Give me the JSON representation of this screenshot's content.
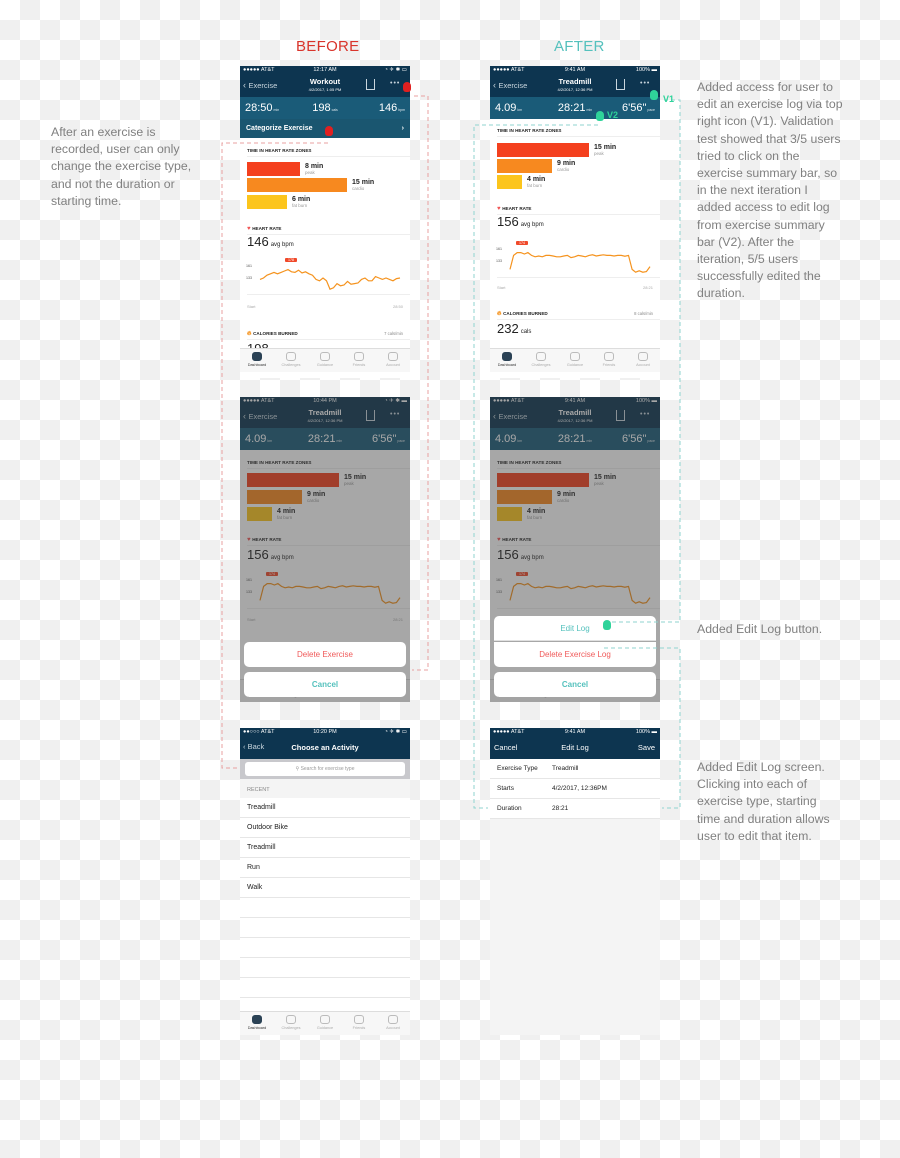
{
  "labels": {
    "before": "BEFORE",
    "after": "AFTER",
    "before_color": "#d9342b",
    "after_color": "#55c1bd"
  },
  "notes": {
    "left": "After an exercise is\nrecorded, user can only\nchange the exercise type,\nand not the duration or\nstarting time.",
    "v1v2": "Added access for user to\nedit an exercise log via top\nright icon (V1). Validation\ntest showed that 3/5 users\ntried to click on the\nexercise summary bar, so\nin the next iteration I\nadded access to edit log\nfrom exercise summary\nbar (V2). After the\niteration, 5/5 users\nsuccessfully edited the\nduration.",
    "edit_button": "Added Edit Log button.",
    "edit_screen": "Added Edit Log screen.\nClicking into each of\nexercise type, starting\ntime and duration allows\nuser to edit that item."
  },
  "markers": {
    "v1": "V1",
    "v2": "V2"
  },
  "tabs": [
    "Dashboard",
    "Challenges",
    "Guidance",
    "Friends",
    "Account"
  ],
  "before_summary": {
    "status": {
      "carrier": "●●●●● AT&T",
      "time": "12:17 AM",
      "right": "◔ ✈ ✱ ▭"
    },
    "nav": {
      "back": "Exercise",
      "title": "Workout",
      "subtitle": "4/2/2017, 1:05 PM"
    },
    "stats": [
      {
        "value": "28:50",
        "unit": "min"
      },
      {
        "value": "198",
        "unit": "cals"
      },
      {
        "value": "146",
        "unit": "bpm"
      }
    ],
    "categorize": "Categorize Exercise",
    "zones_title": "TIME IN HEART RATE ZONES",
    "zones": [
      {
        "value": "8 min",
        "label": "peak"
      },
      {
        "value": "15 min",
        "label": "cardio"
      },
      {
        "value": "6 min",
        "label": "fat burn"
      }
    ],
    "heart_title": "HEART RATE",
    "avg": "146",
    "avg_unit": "avg bpm",
    "ticks": [
      "161",
      "133"
    ],
    "peak_badge": "178",
    "x_start": "Start",
    "x_end": "28:50",
    "cal_title": "CALORIES BURNED",
    "cal_rate": "7 cals/min",
    "cal_value": "198"
  },
  "after_summary": {
    "status": {
      "carrier": "●●●●● AT&T",
      "time": "9:41 AM",
      "right": "100% ▬"
    },
    "nav": {
      "back": "Exercise",
      "title": "Treadmill",
      "subtitle": "4/2/2017, 12:36 PM"
    },
    "stats": [
      {
        "value": "4.09",
        "unit": "km"
      },
      {
        "value": "28:21",
        "unit": "min"
      },
      {
        "value": "6'56\"",
        "unit": "pace"
      }
    ],
    "zones_title": "TIME IN HEART RATE ZONES",
    "zones": [
      {
        "value": "15 min",
        "label": "peak"
      },
      {
        "value": "9 min",
        "label": "cardio"
      },
      {
        "value": "4 min",
        "label": "fat burn"
      }
    ],
    "heart_title": "HEART RATE",
    "avg": "156",
    "avg_unit": "avg bpm",
    "ticks": [
      "161",
      "133"
    ],
    "peak_badge": "174",
    "x_start": "Start",
    "x_end": "28:21",
    "cal_title": "CALORIES BURNED",
    "cal_rate": "8 cals/min",
    "cal_value": "232",
    "cal_unit": "cals"
  },
  "before_delete": {
    "status": {
      "carrier": "●●●●● AT&T",
      "time": "10:44 PM",
      "right": "◔ ✈ ✱ ▬"
    },
    "nav": {
      "back": "Exercise",
      "title": "Treadmill",
      "subtitle": "4/2/2017, 12:36 PM"
    },
    "stats": [
      {
        "value": "4.09",
        "unit": "km"
      },
      {
        "value": "28:21",
        "unit": "min"
      },
      {
        "value": "6'56\"",
        "unit": "pace"
      }
    ],
    "zones_title": "TIME IN HEART RATE ZONES",
    "zones": [
      {
        "value": "15 min",
        "label": "peak"
      },
      {
        "value": "9 min",
        "label": "cardio"
      },
      {
        "value": "4 min",
        "label": "fat burn"
      }
    ],
    "heart_title": "HEART RATE",
    "avg": "156",
    "avg_unit": "avg bpm",
    "ticks": [
      "161",
      "133"
    ],
    "peak_badge": "174",
    "x_start": "Start",
    "x_end": "28:21",
    "sheet": {
      "delete": "Delete Exercise",
      "cancel": "Cancel"
    }
  },
  "after_action": {
    "status": {
      "carrier": "●●●●● AT&T",
      "time": "9:41 AM",
      "right": "100% ▬"
    },
    "nav": {
      "back": "Exercise",
      "title": "Treadmill",
      "subtitle": "4/2/2017, 12:36 PM"
    },
    "stats": [
      {
        "value": "4.09",
        "unit": "km"
      },
      {
        "value": "28:21",
        "unit": "min"
      },
      {
        "value": "6'56\"",
        "unit": "pace"
      }
    ],
    "zones_title": "TIME IN HEART RATE ZONES",
    "zones": [
      {
        "value": "15 min",
        "label": "peak"
      },
      {
        "value": "9 min",
        "label": "cardio"
      },
      {
        "value": "4 min",
        "label": "fat burn"
      }
    ],
    "heart_title": "HEART RATE",
    "avg": "156",
    "avg_unit": "avg bpm",
    "ticks": [
      "161",
      "133"
    ],
    "peak_badge": "174",
    "x_start": "Start",
    "x_end": "28:21",
    "sheet": {
      "edit": "Edit Log",
      "delete": "Delete Exercise Log",
      "cancel": "Cancel"
    }
  },
  "choose_activity": {
    "status": {
      "carrier": "●●○○○ AT&T",
      "time": "10:20 PM",
      "right": "◔ ✈ ✱ ▭"
    },
    "back": "Back",
    "title": "Choose an Activity",
    "search_placeholder": "Search for exercise type",
    "section": "RECENT",
    "items": [
      "Treadmill",
      "Outdoor Bike",
      "Treadmill",
      "Run",
      "Walk"
    ]
  },
  "edit_log": {
    "status": {
      "carrier": "●●●●● AT&T",
      "time": "9:41 AM",
      "right": "100% ▬"
    },
    "cancel": "Cancel",
    "title": "Edit Log",
    "save": "Save",
    "rows": [
      {
        "label": "Exercise Type",
        "value": "Treadmill"
      },
      {
        "label": "Starts",
        "value": "4/2/2017, 12:36PM"
      },
      {
        "label": "Duration",
        "value": "28:21"
      }
    ]
  },
  "colors": {
    "nav": "#0d3550",
    "summary": "#1a5b78",
    "peak": "#f4401e",
    "cardio": "#f7891f",
    "fatburn": "#fcc51c",
    "delete": "#f05a5a",
    "action": "#55c1bd"
  }
}
